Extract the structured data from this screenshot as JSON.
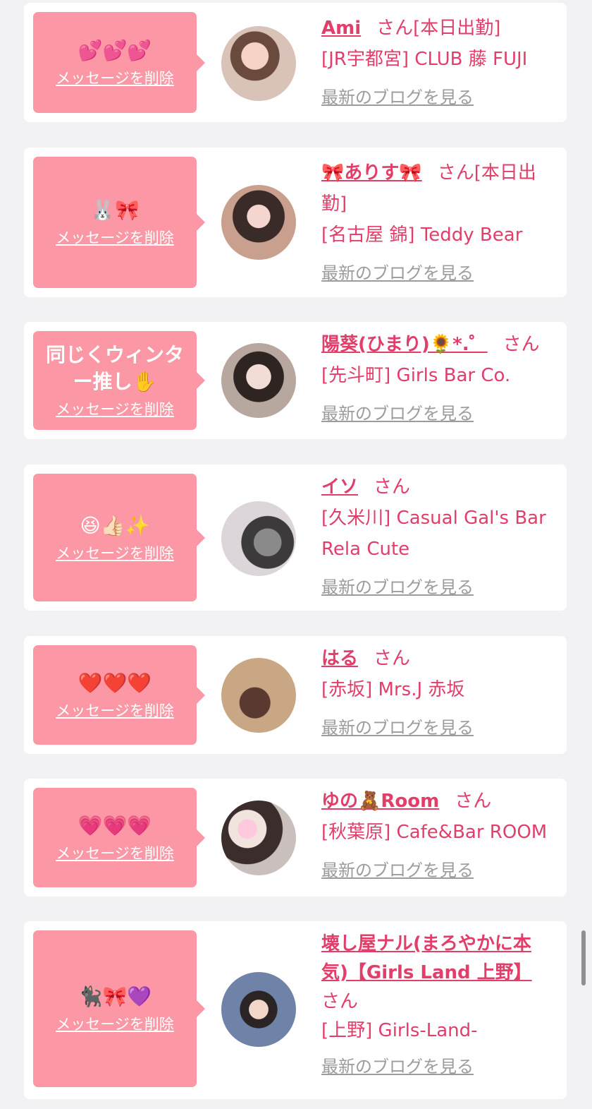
{
  "common": {
    "san": "さん",
    "delete_label": "メッセージを削除",
    "blog_label": "最新のブログを見る"
  },
  "colors": {
    "bubble": "#fc97a5",
    "name": "#e23e6a",
    "link_gray": "#9c9c9c",
    "background": "#f2f2f4"
  },
  "items": [
    {
      "message": "💕💕💕",
      "name": "Ami",
      "status": "[本日出勤]",
      "shop": "[JR宇都宮] CLUB 藤 FUJI",
      "avatar_icon": "woman-selfie-photo"
    },
    {
      "message": "🐰🎀",
      "name": "🎀ありす🎀",
      "status": "[本日出勤]",
      "shop": "[名古屋 錦] Teddy Bear",
      "avatar_icon": "girl-with-bows-photo"
    },
    {
      "message": "同じくウィンター推し✋",
      "name": "陽葵(ひまり)🌻*.゜",
      "status": "",
      "shop": "[先斗町] Girls Bar Co.",
      "avatar_icon": "girl-peace-sign-photo"
    },
    {
      "message": "😆👍🏻✨",
      "name": "イソ",
      "status": "",
      "shop": "[久米川] Casual Gal's Bar Rela Cute",
      "avatar_icon": "girl-with-cat-photo"
    },
    {
      "message": "❤️❤️❤️",
      "name": "はる",
      "status": "",
      "shop": "[赤坂] Mrs.J 赤坂",
      "avatar_icon": "woman-back-view-photo"
    },
    {
      "message": "💗💗💗",
      "name": "ゆの🧸Room",
      "status": "",
      "shop": "[秋葉原] Cafe&Bar ROOM",
      "avatar_icon": "two-girls-photo"
    },
    {
      "message": "🐈‍⬛🎀💜",
      "name": "壊し屋ナル(まろやかに本気)【Girls Land 上野】",
      "status": "",
      "shop": "[上野] Girls-Land-",
      "avatar_icon": "girl-mouse-ears-photo"
    }
  ]
}
